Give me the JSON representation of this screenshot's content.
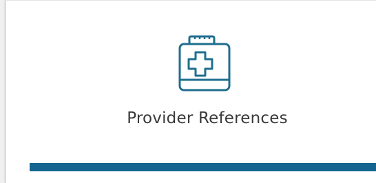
{
  "card": {
    "title": "Provider References",
    "icon": "medical-kit-icon",
    "accent_color": "#13658f",
    "icon_color": "#1f6e8f"
  }
}
